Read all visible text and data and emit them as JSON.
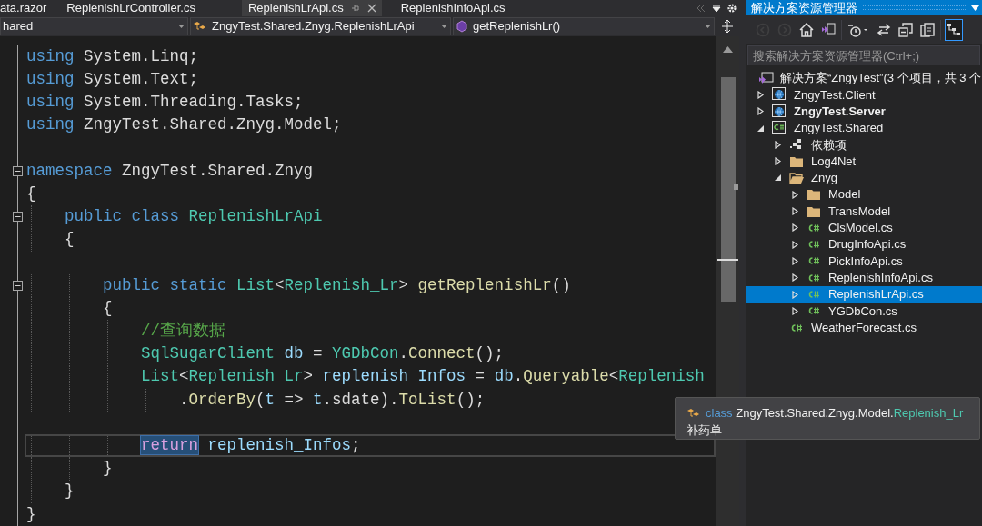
{
  "editor": {
    "tabs": [
      {
        "label": "ata.razor",
        "selected": false
      },
      {
        "label": "ReplenishLrController.cs",
        "selected": false
      },
      {
        "label": "ReplenishLrApi.cs",
        "selected": true
      },
      {
        "label": "ReplenishInfoApi.cs",
        "selected": false
      }
    ],
    "navigation_bar": {
      "project": "hared",
      "type": "ZngyTest.Shared.Znyg.ReplenishLrApi",
      "member": "getReplenishLr()"
    },
    "lines": [
      {
        "foldable": false,
        "current": false,
        "tokens": [
          {
            "text": "using",
            "kind": "keyword",
            "highlighted": false
          },
          {
            "text": " System.Linq;",
            "kind": "plain",
            "highlighted": false
          }
        ]
      },
      {
        "foldable": false,
        "current": false,
        "tokens": [
          {
            "text": "using",
            "kind": "keyword",
            "highlighted": false
          },
          {
            "text": " System.Text;",
            "kind": "plain",
            "highlighted": false
          }
        ]
      },
      {
        "foldable": false,
        "current": false,
        "tokens": [
          {
            "text": "using",
            "kind": "keyword",
            "highlighted": false
          },
          {
            "text": " System.Threading.Tasks;",
            "kind": "plain",
            "highlighted": false
          }
        ]
      },
      {
        "foldable": false,
        "current": false,
        "tokens": [
          {
            "text": "using",
            "kind": "keyword",
            "highlighted": false
          },
          {
            "text": " ZngyTest.Shared.Znyg.Model;",
            "kind": "plain",
            "highlighted": false
          }
        ]
      },
      {
        "foldable": false,
        "current": false
      },
      {
        "foldable": true,
        "current": false,
        "tokens": [
          {
            "text": "namespace",
            "kind": "keyword",
            "highlighted": false
          },
          {
            "text": " ZngyTest.Shared.Znyg",
            "kind": "plain",
            "highlighted": false
          }
        ]
      },
      {
        "foldable": false,
        "current": false,
        "tokens": [
          {
            "text": "{",
            "kind": "plain",
            "highlighted": false
          }
        ]
      },
      {
        "foldable": true,
        "current": false,
        "tokens": [
          {
            "text": "    public",
            "kind": "keyword",
            "highlighted": false
          },
          {
            "text": " class",
            "kind": "keyword",
            "highlighted": false
          },
          {
            "text": " ReplenishLrApi",
            "kind": "type",
            "highlighted": false
          }
        ]
      },
      {
        "foldable": false,
        "current": false,
        "tokens": [
          {
            "text": "    {",
            "kind": "plain",
            "highlighted": false
          }
        ]
      },
      {
        "foldable": false,
        "current": false
      },
      {
        "foldable": true,
        "current": false,
        "tokens": [
          {
            "text": "        public",
            "kind": "keyword",
            "highlighted": false
          },
          {
            "text": " static",
            "kind": "keyword",
            "highlighted": false
          },
          {
            "text": " List",
            "kind": "type",
            "highlighted": false
          },
          {
            "text": "<",
            "kind": "plain",
            "highlighted": false
          },
          {
            "text": "Replenish_Lr",
            "kind": "type",
            "highlighted": false
          },
          {
            "text": "> ",
            "kind": "plain",
            "highlighted": false
          },
          {
            "text": "getReplenishLr",
            "kind": "method",
            "highlighted": false
          },
          {
            "text": "()",
            "kind": "plain",
            "highlighted": false
          }
        ]
      },
      {
        "foldable": false,
        "current": false,
        "tokens": [
          {
            "text": "        {",
            "kind": "plain",
            "highlighted": false
          }
        ]
      },
      {
        "foldable": false,
        "current": false,
        "tokens": [
          {
            "text": "            //查询数据",
            "kind": "comment",
            "highlighted": false
          }
        ]
      },
      {
        "foldable": false,
        "current": false,
        "tokens": [
          {
            "text": "            SqlSugarClient",
            "kind": "type",
            "highlighted": false
          },
          {
            "text": " db",
            "kind": "variable",
            "highlighted": false
          },
          {
            "text": " = ",
            "kind": "plain",
            "highlighted": false
          },
          {
            "text": "YGDbCon",
            "kind": "type",
            "highlighted": false
          },
          {
            "text": ".",
            "kind": "plain",
            "highlighted": false
          },
          {
            "text": "Connect",
            "kind": "method",
            "highlighted": false
          },
          {
            "text": "();",
            "kind": "plain",
            "highlighted": false
          }
        ]
      },
      {
        "foldable": false,
        "current": false,
        "tokens": [
          {
            "text": "            List",
            "kind": "type",
            "highlighted": false
          },
          {
            "text": "<",
            "kind": "plain",
            "highlighted": false
          },
          {
            "text": "Replenish_Lr",
            "kind": "type",
            "highlighted": false
          },
          {
            "text": "> ",
            "kind": "plain",
            "highlighted": false
          },
          {
            "text": "replenish_Infos",
            "kind": "variable",
            "highlighted": false
          },
          {
            "text": " = ",
            "kind": "plain",
            "highlighted": false
          },
          {
            "text": "db",
            "kind": "variable",
            "highlighted": false
          },
          {
            "text": ".",
            "kind": "plain",
            "highlighted": false
          },
          {
            "text": "Queryable",
            "kind": "method",
            "highlighted": false
          },
          {
            "text": "<",
            "kind": "plain",
            "highlighted": false
          },
          {
            "text": "Replenish_",
            "kind": "type",
            "highlighted": false
          }
        ]
      },
      {
        "foldable": false,
        "current": false,
        "tokens": [
          {
            "text": "                .",
            "kind": "plain",
            "highlighted": false
          },
          {
            "text": "OrderBy",
            "kind": "method",
            "highlighted": false
          },
          {
            "text": "(",
            "kind": "plain",
            "highlighted": false
          },
          {
            "text": "t",
            "kind": "variable",
            "highlighted": false
          },
          {
            "text": " => ",
            "kind": "plain",
            "highlighted": false
          },
          {
            "text": "t",
            "kind": "variable",
            "highlighted": false
          },
          {
            "text": ".sdate).",
            "kind": "plain",
            "highlighted": false
          },
          {
            "text": "ToList",
            "kind": "method",
            "highlighted": false
          },
          {
            "text": "();",
            "kind": "plain",
            "highlighted": false
          }
        ]
      },
      {
        "foldable": false,
        "current": false
      },
      {
        "foldable": false,
        "current": true,
        "tokens": [
          {
            "text": "            return",
            "kind": "control",
            "highlighted": true
          },
          {
            "text": " replenish_Infos",
            "kind": "variable",
            "highlighted": false
          },
          {
            "text": ";",
            "kind": "plain",
            "highlighted": false
          }
        ]
      },
      {
        "foldable": false,
        "current": false,
        "tokens": [
          {
            "text": "        }",
            "kind": "plain",
            "highlighted": false
          }
        ]
      },
      {
        "foldable": false,
        "current": false,
        "tokens": [
          {
            "text": "    }",
            "kind": "plain",
            "highlighted": false
          }
        ]
      },
      {
        "foldable": false,
        "current": false,
        "tokens": [
          {
            "text": "}",
            "kind": "plain",
            "highlighted": false
          }
        ]
      }
    ],
    "tooltip": {
      "signature": [
        {
          "text": "class",
          "kind": "keyword"
        },
        {
          "text": " ZngyTest.Shared.Znyg.Model.",
          "kind": "plain"
        },
        {
          "text": "Replenish_Lr",
          "kind": "type"
        }
      ],
      "description": "补药单"
    }
  },
  "solution_explorer": {
    "title": "解决方案资源管理器",
    "toolbar": [
      {
        "kind": "back",
        "disabled": true,
        "on": false
      },
      {
        "kind": "forward",
        "disabled": true,
        "on": false
      },
      {
        "kind": "home",
        "disabled": false,
        "on": false
      },
      {
        "kind": "switch-views",
        "disabled": false,
        "on": false
      },
      {
        "kind": "pending-changes",
        "disabled": false,
        "on": false
      },
      {
        "kind": "sync",
        "disabled": false,
        "on": false
      },
      {
        "kind": "collapse-all",
        "disabled": false,
        "on": false
      },
      {
        "kind": "show-all-files",
        "disabled": false,
        "on": false
      },
      {
        "kind": "preview",
        "disabled": false,
        "on": true
      }
    ],
    "search": {
      "placeholder": "搜索解决方案资源管理器(Ctrl+;)"
    },
    "solution": {
      "label": "解决方案“ZngyTest”(3 个项目，共 3 个",
      "children": [
        {
          "label": "ZngyTest.Client",
          "kind": "web-project",
          "expanded": false,
          "selected": false,
          "startup": false
        },
        {
          "label": "ZngyTest.Server",
          "kind": "web-project",
          "expanded": false,
          "selected": false,
          "startup": true
        },
        {
          "label": "ZngyTest.Shared",
          "kind": "csharp-project",
          "expanded": true,
          "selected": false,
          "startup": false,
          "children": [
            {
              "label": "依赖项",
              "kind": "dependencies",
              "expanded": false,
              "selected": false,
              "startup": false
            },
            {
              "label": "Log4Net",
              "kind": "folder",
              "expanded": false,
              "selected": false,
              "startup": false
            },
            {
              "label": "Znyg",
              "kind": "folder",
              "expanded": true,
              "selected": false,
              "startup": false,
              "children": [
                {
                  "label": "Model",
                  "kind": "folder",
                  "expanded": false,
                  "selected": false,
                  "startup": false
                },
                {
                  "label": "TransModel",
                  "kind": "folder",
                  "expanded": false,
                  "selected": false,
                  "startup": false
                },
                {
                  "label": "ClsModel.cs",
                  "kind": "csharp-file",
                  "expanded": false,
                  "selected": false,
                  "startup": false
                },
                {
                  "label": "DrugInfoApi.cs",
                  "kind": "csharp-file",
                  "expanded": false,
                  "selected": false,
                  "startup": false
                },
                {
                  "label": "PickInfoApi.cs",
                  "kind": "csharp-file",
                  "expanded": false,
                  "selected": false,
                  "startup": false
                },
                {
                  "label": "ReplenishInfoApi.cs",
                  "kind": "csharp-file",
                  "expanded": false,
                  "selected": false,
                  "startup": false
                },
                {
                  "label": "ReplenishLrApi.cs",
                  "kind": "csharp-file",
                  "expanded": false,
                  "selected": true,
                  "startup": false
                },
                {
                  "label": "YGDbCon.cs",
                  "kind": "csharp-file",
                  "expanded": false,
                  "selected": false,
                  "startup": false
                }
              ]
            },
            {
              "label": "WeatherForecast.cs",
              "kind": "csharp-file",
              "selected": false,
              "startup": false
            }
          ]
        }
      ]
    }
  }
}
